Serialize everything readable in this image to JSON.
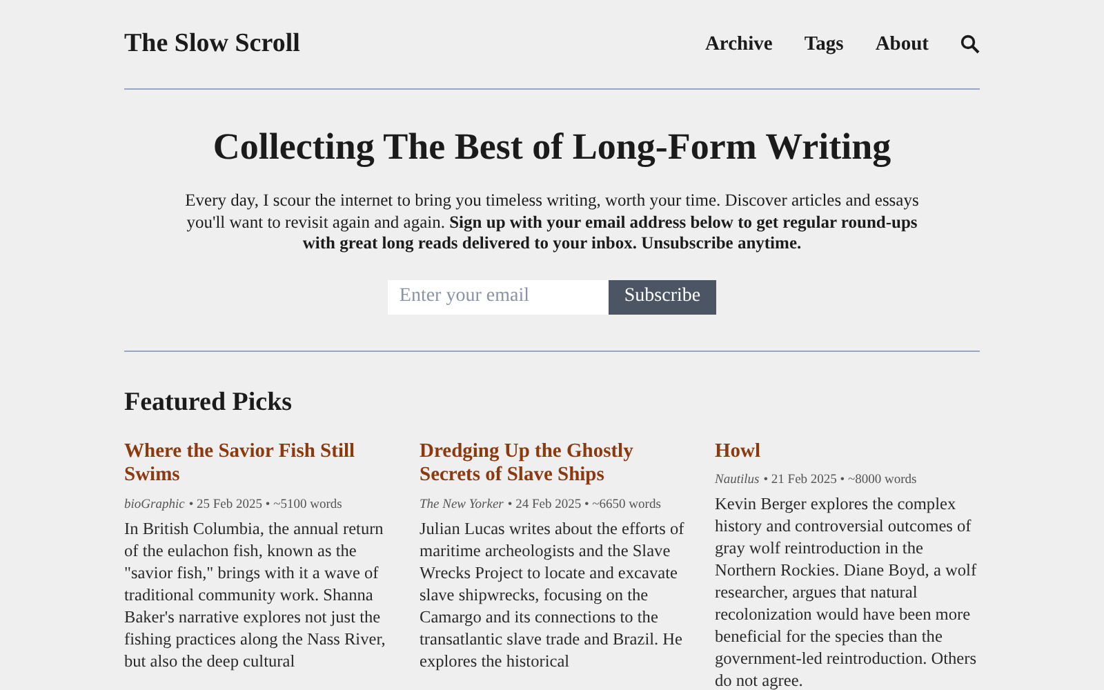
{
  "site": {
    "title": "The Slow Scroll",
    "nav": [
      "Archive",
      "Tags",
      "About"
    ]
  },
  "hero": {
    "heading": "Collecting The Best of Long-Form Writing",
    "intro": "Every day, I scour the internet to bring you timeless writing, worth your time. Discover articles and essays you'll want to revisit again and again. **Sign up with your email address below to get regular round-ups with great long reads delivered to your inbox. Unsubscribe anytime.**",
    "email": {
      "placeholder": "Enter your email"
    },
    "button": "Subscribe"
  },
  "featured": {
    "heading": "Featured Picks",
    "picks": [
      {
        "title": "Where the Savior Fish Still Swims",
        "source": "bioGraphic",
        "details": "• 25 Feb 2025 • ~5100 words",
        "excerpt": "In British Columbia, the annual return of the eulachon fish, known as the \"savior fish,\" brings with it a wave of traditional community work. Shanna Baker's narrative explores not just the fishing practices along the Nass River, but also the deep cultural"
      },
      {
        "title": "Dredging Up the Ghostly Secrets of Slave Ships",
        "source": "The New Yorker",
        "details": "• 24 Feb 2025 • ~6650 words",
        "excerpt": "Julian Lucas writes about the efforts of maritime archeologists and the Slave Wrecks Project to locate and excavate slave shipwrecks, focusing on the Camargo and its connections to the transatlantic slave trade and Brazil. He explores the historical"
      },
      {
        "title": "Howl",
        "source": "Nautilus",
        "details": "• 21 Feb 2025 • ~8000 words",
        "excerpt": "Kevin Berger explores the complex history and controversial outcomes of gray wolf reintroduction in the Northern Rockies. Diane Boyd, a wolf researcher, argues that natural recolonization would have been more beneficial for the species than the government-led reintroduction. Others do not agree."
      }
    ]
  }
}
